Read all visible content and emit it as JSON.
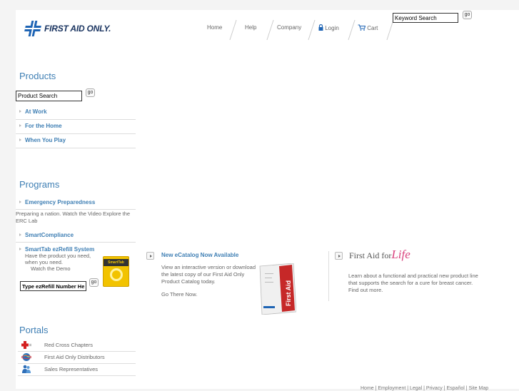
{
  "header": {
    "logo_text": "FIRST AID ONLY.",
    "nav": [
      "Home",
      "Help",
      "Company",
      "Login",
      "Cart"
    ],
    "search_value": "Keyword Search",
    "go_label": "go"
  },
  "products": {
    "title": "Products",
    "search_value": "Product Search",
    "links": [
      "At Work",
      "For the Home",
      "When You Play"
    ]
  },
  "programs": {
    "title": "Programs",
    "emergency": "Emergency Preparedness",
    "emergency_desc": "Preparing a nation. Watch the Video Explore the ERC Lab",
    "compliance": "SmartCompliance",
    "smarttab": "SmartTab ezRefill System",
    "smarttab_desc1": "Have the product you need,",
    "smarttab_desc2": "when you need.",
    "smarttab_desc3": "Watch the Demo",
    "ez_input_value": "Type ezRefill Number Here",
    "smarttab_box_label": "SmartTab"
  },
  "portals": {
    "title": "Portals",
    "items": [
      "Red Cross Chapters",
      "First Aid Only Distributors",
      "Sales Representatives"
    ]
  },
  "promo_catalog": {
    "title": "New eCatalog Now Available",
    "lines": [
      "View an interactive version or download",
      "the latest copy of our First Aid Only",
      "Product Catalog today."
    ],
    "link": "Go There Now.",
    "cover_text": "First Aid"
  },
  "promo_life": {
    "brand_prefix": "First Aid for",
    "brand_script": "Life",
    "lines": [
      "Learn about a functional and practical new product line",
      "that supports the search for a cure for breast cancer."
    ],
    "link": "Find out more."
  },
  "footer": {
    "text": "Home | Employment | Legal | Privacy | Español | Site Map"
  },
  "colors": {
    "link_blue": "#3f7fb4",
    "brand_blue": "#1e64b4",
    "navy": "#1a3460",
    "pink": "#d9437e",
    "smarttab_yellow": "#f2c300"
  }
}
